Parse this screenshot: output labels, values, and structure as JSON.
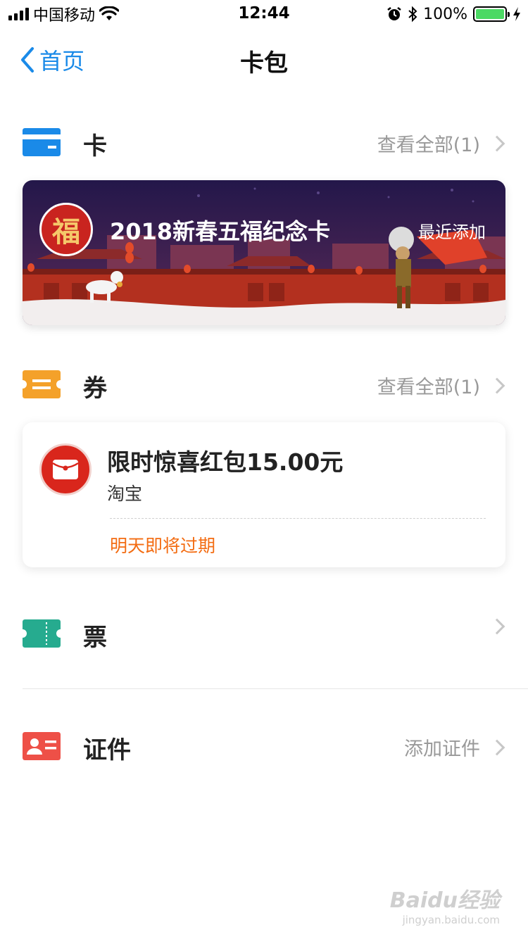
{
  "status_bar": {
    "carrier": "中国移动",
    "time": "12:44",
    "battery": "100%",
    "battery_level": 1.0
  },
  "nav": {
    "back_label": "首页",
    "title": "卡包"
  },
  "sections": {
    "cards": {
      "title": "卡",
      "action": "查看全部(1)",
      "icon_color": "#1a8ae8"
    },
    "coupons": {
      "title": "券",
      "action": "查看全部(1)",
      "icon_color": "#f4a12a"
    },
    "tickets": {
      "title": "票",
      "icon_color": "#26ab8f"
    },
    "ids": {
      "title": "证件",
      "action": "添加证件",
      "icon_color": "#ee5047"
    }
  },
  "card": {
    "badge": "福",
    "name": "2018新春五福纪念卡",
    "tag": "最近添加"
  },
  "coupon": {
    "title": "限时惊喜红包15.00元",
    "issuer": "淘宝",
    "expire": "明天即将过期"
  },
  "watermark": {
    "main": "Baidu经验",
    "sub": "jingyan.baidu.com"
  },
  "colors": {
    "accent": "#1a8ae8",
    "expire": "#f36c12",
    "card_sky": "#2a1a4e",
    "card_wall": "#b3301f"
  }
}
